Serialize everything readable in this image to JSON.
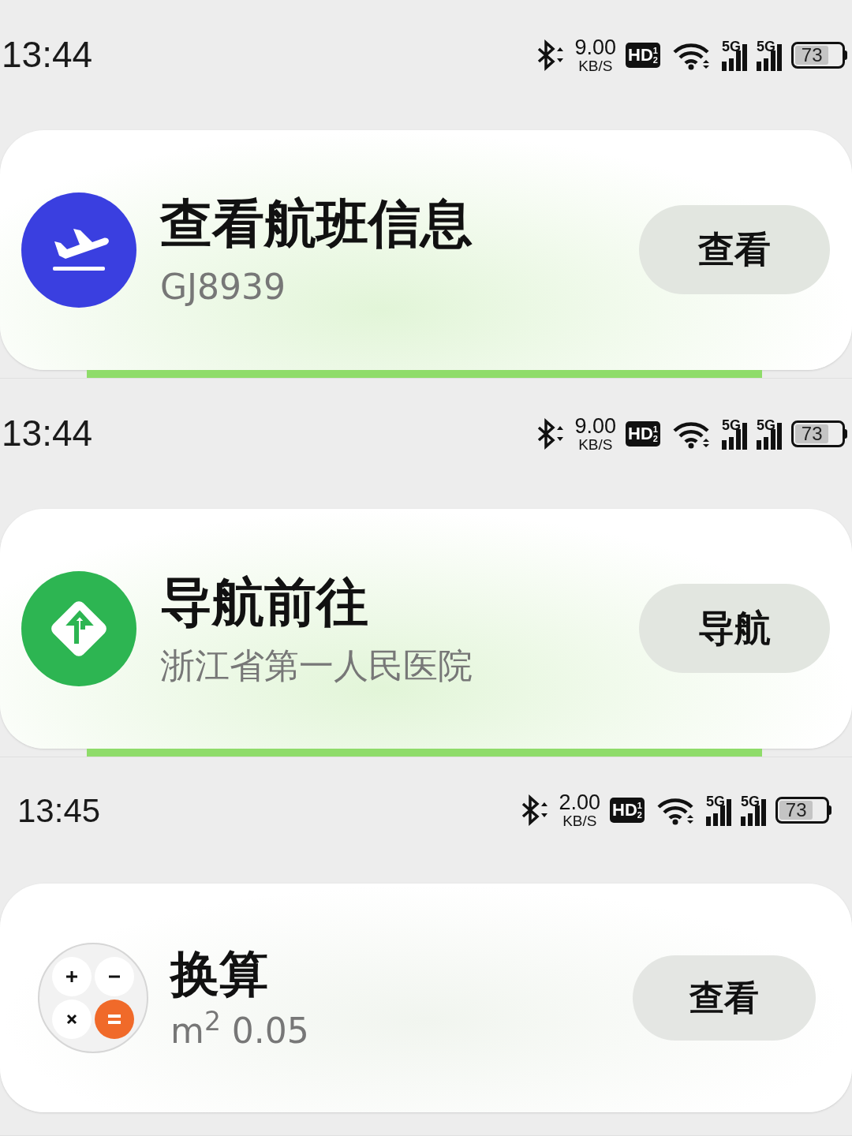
{
  "panels": [
    {
      "status_bar": {
        "time": "13:44",
        "speed": "9.00",
        "speed_unit": "KB/S",
        "hd": {
          "label": "HD",
          "sims": [
            "1",
            "2"
          ]
        },
        "network": [
          "5G",
          "5G"
        ],
        "battery": "73"
      },
      "card": {
        "kind": "flight",
        "title": "查看航班信息",
        "subtitle": "GJ8939",
        "button": "查看"
      },
      "green_strip": true
    },
    {
      "status_bar": {
        "time": "13:44",
        "speed": "9.00",
        "speed_unit": "KB/S",
        "hd": {
          "label": "HD",
          "sims": [
            "1",
            "2"
          ]
        },
        "network": [
          "5G",
          "5G"
        ],
        "battery": "73"
      },
      "card": {
        "kind": "navigation",
        "title": "导航前往",
        "subtitle": "浙江省第一人民医院",
        "button": "导航"
      },
      "green_strip": true
    },
    {
      "status_bar": {
        "time": "13:45",
        "speed": "2.00",
        "speed_unit": "KB/S",
        "hd": {
          "label": "HD",
          "sims": [
            "1",
            "2"
          ]
        },
        "network": [
          "5G",
          "5G"
        ],
        "battery": "73"
      },
      "card": {
        "kind": "calculator",
        "title": "换算",
        "subtitle": "m$^{2}$ 0.05",
        "button": "查看"
      },
      "green_strip": false
    }
  ]
}
